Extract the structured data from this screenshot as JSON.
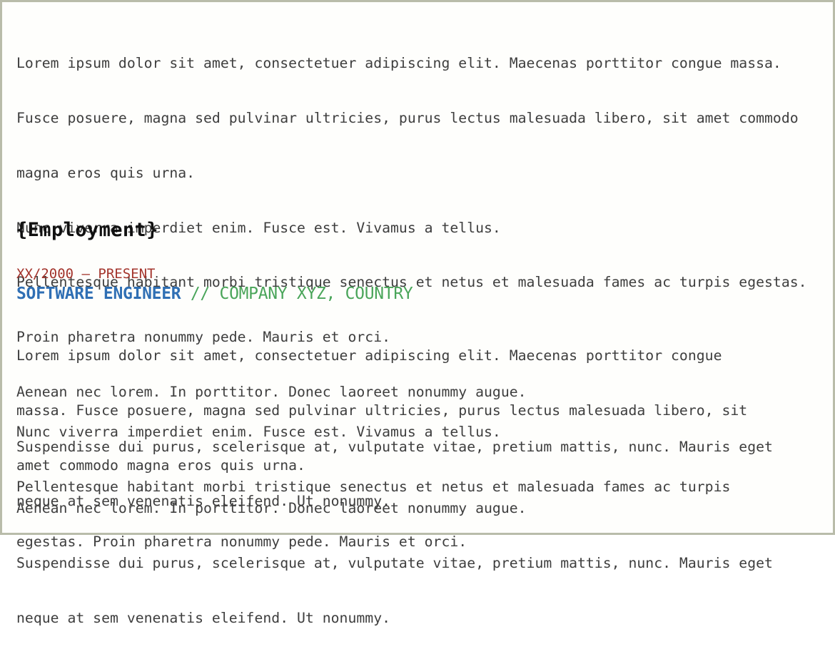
{
  "summary": {
    "lines": [
      "Lorem ipsum dolor sit amet, consectetuer adipiscing elit. Maecenas porttitor congue massa.",
      "Fusce posuere, magna sed pulvinar ultricies, purus lectus malesuada libero, sit amet commodo",
      "magna eros quis urna.",
      "Nunc viverra imperdiet enim. Fusce est. Vivamus a tellus.",
      "Pellentesque habitant morbi tristique senectus et netus et malesuada fames ac turpis egestas.",
      "Proin pharetra nonummy pede. Mauris et orci.",
      "Aenean nec lorem. In porttitor. Donec laoreet nonummy augue.",
      "Suspendisse dui purus, scelerisque at, vulputate vitae, pretium mattis, nunc. Mauris eget",
      "neque at sem venenatis eleifend. Ut nonummy."
    ]
  },
  "employment": {
    "heading": "{Employment}",
    "jobs": [
      {
        "dates": "XX/2000 – PRESENT",
        "title": "SOFTWARE ENGINEER",
        "separator": " // ",
        "company": "COMPANY XYZ, COUNTRY",
        "paragraphs": [
          [
            "Lorem ipsum dolor sit amet, consectetuer adipiscing elit. Maecenas porttitor congue",
            "massa. Fusce posuere, magna sed pulvinar ultricies, purus lectus malesuada libero, sit",
            "amet commodo magna eros quis urna."
          ],
          [
            "Nunc viverra imperdiet enim. Fusce est. Vivamus a tellus.",
            "Pellentesque habitant morbi tristique senectus et netus et malesuada fames ac turpis",
            "egestas. Proin pharetra nonummy pede. Mauris et orci."
          ],
          [
            "Aenean nec lorem. In porttitor. Donec laoreet nonummy augue.",
            "Suspendisse dui purus, scelerisque at, vulputate vitae, pretium mattis, nunc. Mauris eget",
            "neque at sem venenatis eleifend. Ut nonummy."
          ]
        ]
      }
    ]
  },
  "colors": {
    "border": "#b9bcaa",
    "body_text": "#3e3e3e",
    "heading": "#111111",
    "dates": "#a3342c",
    "job_title": "#2f6fb4",
    "company": "#4aa55a"
  }
}
